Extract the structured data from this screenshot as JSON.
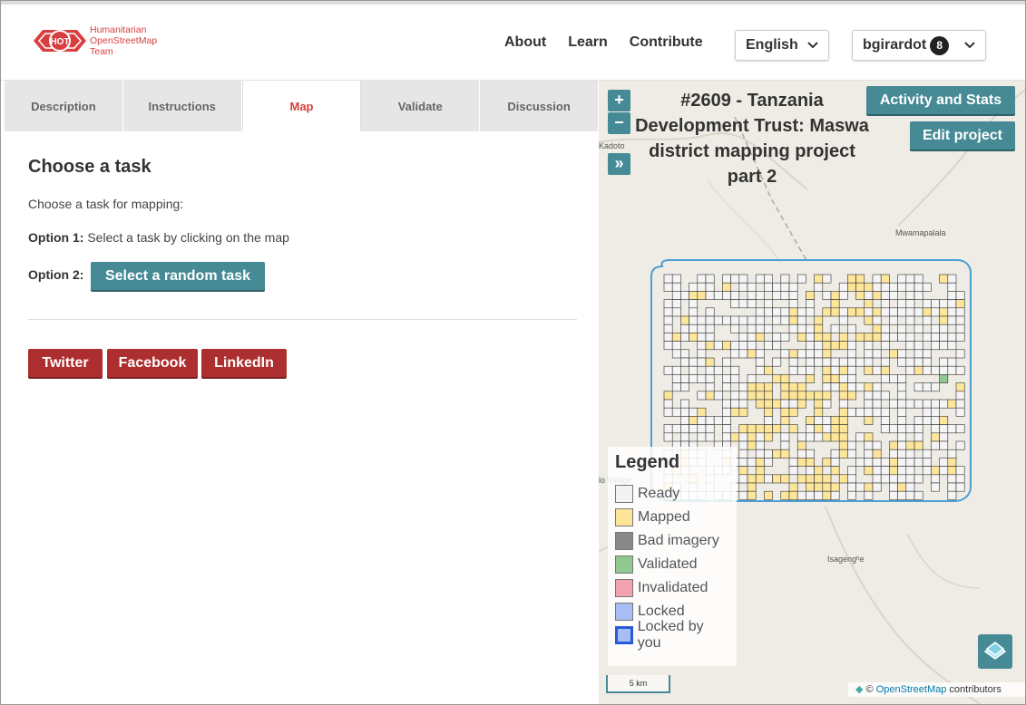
{
  "header": {
    "logo_abbr": "HOT",
    "logo_line1": "Humanitarian",
    "logo_line2": "OpenStreetMap",
    "logo_line3": "Team",
    "nav": [
      "About",
      "Learn",
      "Contribute"
    ],
    "language": "English",
    "username": "bgirardot",
    "notification_count": "8"
  },
  "tabs": [
    "Description",
    "Instructions",
    "Map",
    "Validate",
    "Discussion"
  ],
  "active_tab": "Map",
  "task_panel": {
    "heading": "Choose a task",
    "intro": "Choose a task for mapping:",
    "option1_label": "Option 1:",
    "option1_text": "Select a task by clicking on the map",
    "option2_label": "Option 2:",
    "random_button": "Select a random task"
  },
  "share": [
    "Twitter",
    "Facebook",
    "LinkedIn"
  ],
  "map": {
    "title": "#2609 - Tanzania Development Trust: Maswa district mapping project part 2",
    "zoom_in": "+",
    "zoom_out": "−",
    "expand": "»",
    "activity_button": "Activity and Stats",
    "edit_button": "Edit project",
    "places": [
      "Kadoto",
      "Mwamapalala",
      "Isagengʰe",
      "lo Village"
    ],
    "scale": "5 km",
    "attribution_prefix": "©",
    "attribution_link": "OpenStreetMap",
    "attribution_suffix": "contributors",
    "legend_title": "Legend",
    "legend": [
      {
        "label": "Ready",
        "color": "#f3f3f3"
      },
      {
        "label": "Mapped",
        "color": "#fde59a"
      },
      {
        "label": "Bad imagery",
        "color": "#888888"
      },
      {
        "label": "Validated",
        "color": "#8fc98f"
      },
      {
        "label": "Invalidated",
        "color": "#f4a1b1"
      },
      {
        "label": "Locked",
        "color": "#a7bdf3"
      },
      {
        "label": "Locked by you",
        "color": "#a7bdf3"
      }
    ]
  }
}
